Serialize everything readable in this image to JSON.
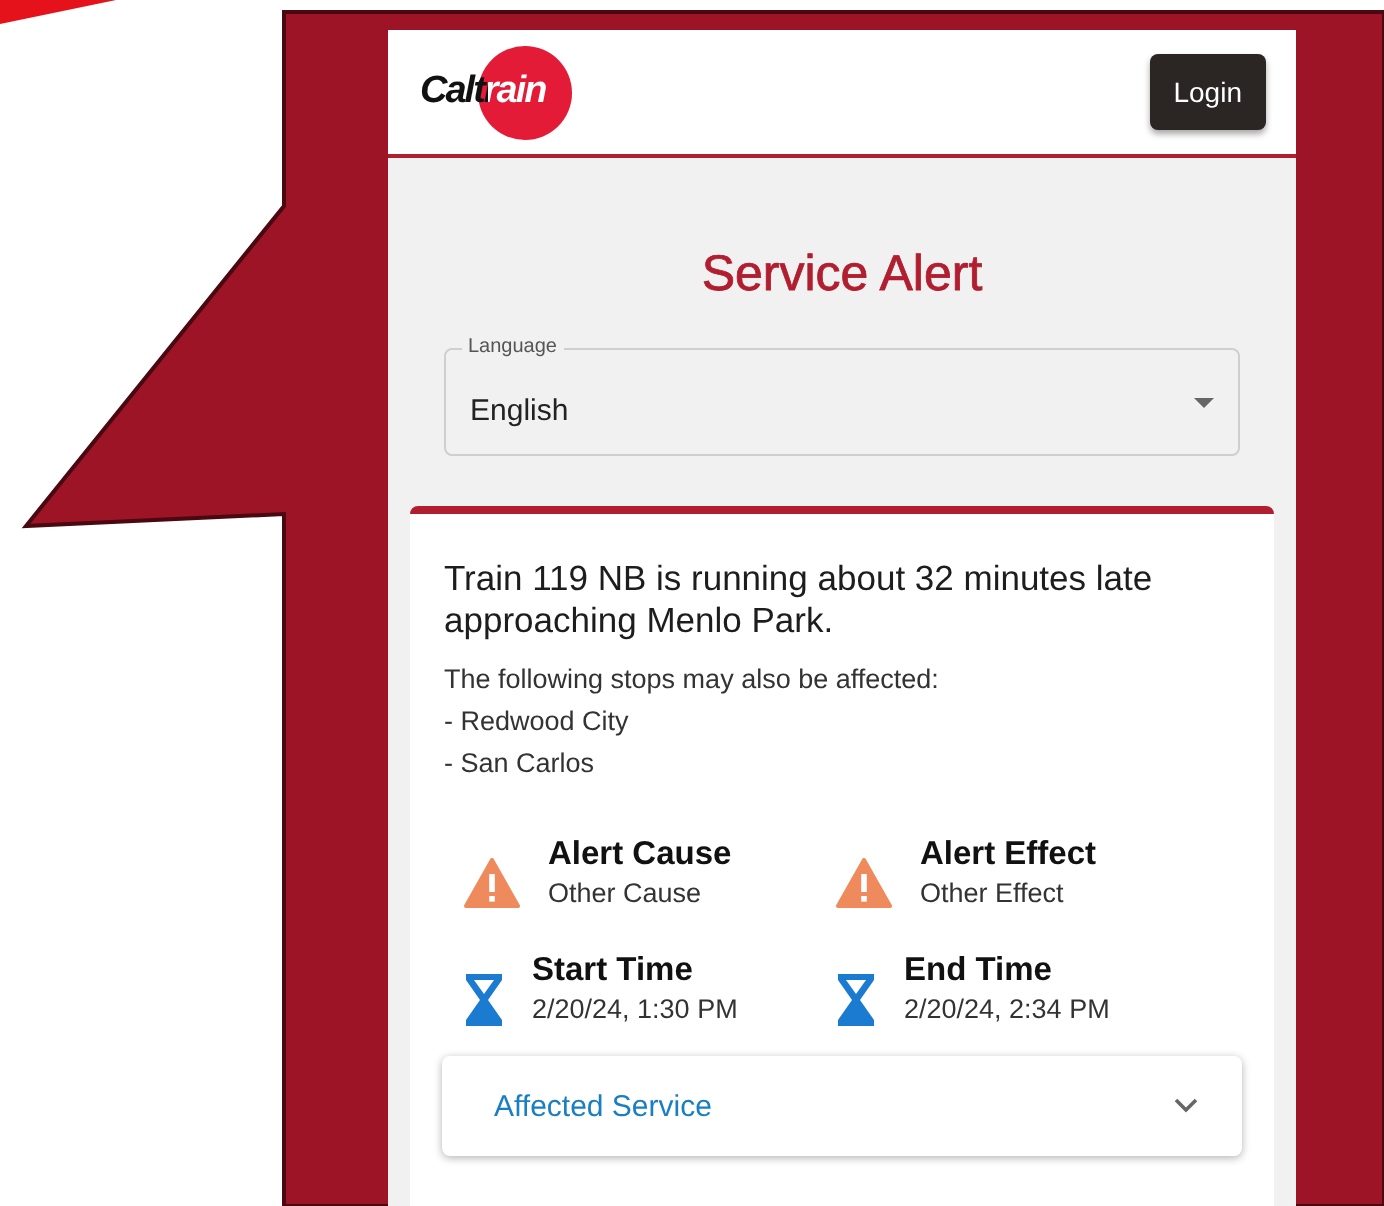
{
  "header": {
    "logo": "Caltrain",
    "login_button": "Login"
  },
  "page_title": "Service Alert",
  "language_select": {
    "label": "Language",
    "value": "English"
  },
  "alert": {
    "headline": "Train 119 NB is running about 32 minutes late approaching Menlo Park.",
    "intro": "The following stops may also be affected:",
    "stops": [
      "- Redwood City",
      "- San Carlos"
    ],
    "details": [
      {
        "kind": "warning",
        "label": "Alert Cause",
        "value": "Other Cause"
      },
      {
        "kind": "warning",
        "label": "Alert Effect",
        "value": "Other Effect"
      },
      {
        "kind": "hourglass",
        "label": "Start Time",
        "value": "2/20/24, 1:30 PM"
      },
      {
        "kind": "hourglass",
        "label": "End Time",
        "value": "2/20/24, 2:34 PM"
      }
    ],
    "affected_service": {
      "label": "Affected Service",
      "expanded": false
    }
  }
}
